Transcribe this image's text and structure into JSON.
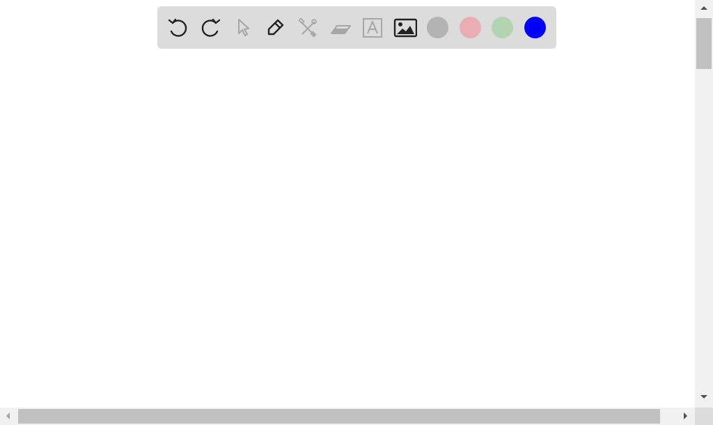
{
  "toolbar": {
    "tools": [
      {
        "name": "undo",
        "icon": "undo-icon",
        "enabled": true
      },
      {
        "name": "redo",
        "icon": "redo-icon",
        "enabled": true
      },
      {
        "name": "select",
        "icon": "cursor-icon",
        "enabled": false
      },
      {
        "name": "pen",
        "icon": "pencil-icon",
        "enabled": true
      },
      {
        "name": "tools",
        "icon": "tools-icon",
        "enabled": false
      },
      {
        "name": "eraser",
        "icon": "eraser-icon",
        "enabled": false
      },
      {
        "name": "text",
        "icon": "text-icon",
        "enabled": false
      },
      {
        "name": "image",
        "icon": "image-icon",
        "enabled": true
      }
    ],
    "colors": [
      "#b3b3b3",
      "#e8aeb3",
      "#b3d4b0",
      "#0000ff"
    ],
    "active_color": "#0000ff",
    "icon_color_enabled": "#222222",
    "icon_color_disabled": "#a6a6a6"
  }
}
